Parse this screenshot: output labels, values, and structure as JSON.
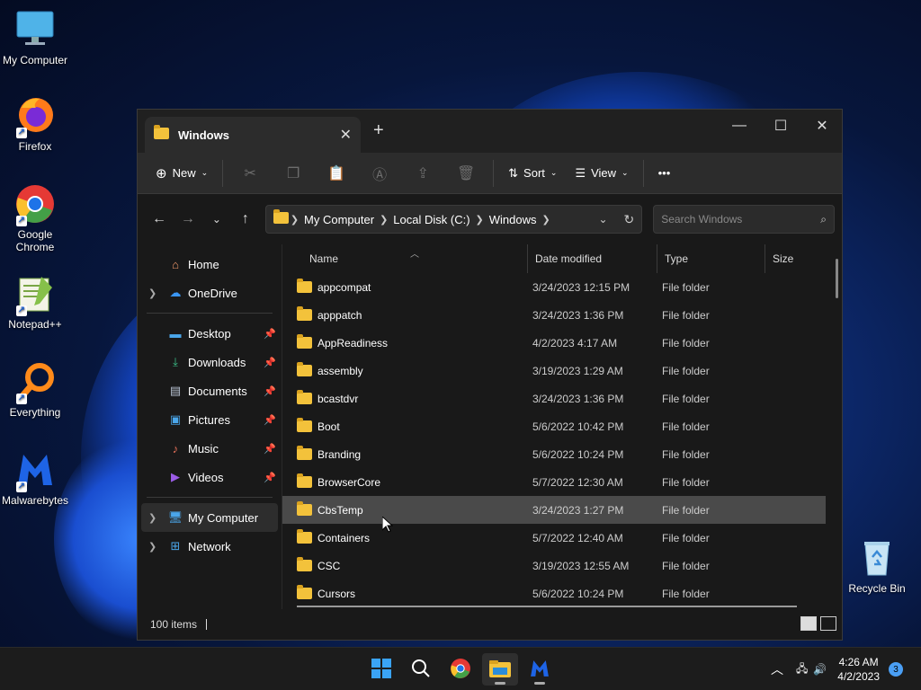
{
  "desktop": {
    "icons": [
      {
        "label": "My Computer"
      },
      {
        "label": "Firefox"
      },
      {
        "label": "Google Chrome"
      },
      {
        "label": "Notepad++"
      },
      {
        "label": "Everything"
      },
      {
        "label": "Malwarebytes"
      },
      {
        "label": "Recycle Bin"
      }
    ]
  },
  "window": {
    "tab_title": "Windows",
    "toolbar": {
      "new_label": "New",
      "sort_label": "Sort",
      "view_label": "View",
      "more_label": "•••"
    },
    "address": {
      "crumbs": [
        "My Computer",
        "Local Disk (C:)",
        "Windows"
      ]
    },
    "search": {
      "placeholder": "Search Windows"
    },
    "nav": {
      "home": "Home",
      "onedrive": "OneDrive",
      "desktop": "Desktop",
      "downloads": "Downloads",
      "documents": "Documents",
      "pictures": "Pictures",
      "music": "Music",
      "videos": "Videos",
      "mycomputer": "My Computer",
      "network": "Network"
    },
    "columns": {
      "name": "Name",
      "date": "Date modified",
      "type": "Type",
      "size": "Size"
    },
    "files": [
      {
        "name": "appcompat",
        "date": "3/24/2023 12:15 PM",
        "type": "File folder"
      },
      {
        "name": "apppatch",
        "date": "3/24/2023 1:36 PM",
        "type": "File folder"
      },
      {
        "name": "AppReadiness",
        "date": "4/2/2023 4:17 AM",
        "type": "File folder"
      },
      {
        "name": "assembly",
        "date": "3/19/2023 1:29 AM",
        "type": "File folder"
      },
      {
        "name": "bcastdvr",
        "date": "3/24/2023 1:36 PM",
        "type": "File folder"
      },
      {
        "name": "Boot",
        "date": "5/6/2022 10:42 PM",
        "type": "File folder"
      },
      {
        "name": "Branding",
        "date": "5/6/2022 10:24 PM",
        "type": "File folder"
      },
      {
        "name": "BrowserCore",
        "date": "5/7/2022 12:30 AM",
        "type": "File folder"
      },
      {
        "name": "CbsTemp",
        "date": "3/24/2023 1:27 PM",
        "type": "File folder"
      },
      {
        "name": "Containers",
        "date": "5/7/2022 12:40 AM",
        "type": "File folder"
      },
      {
        "name": "CSC",
        "date": "3/19/2023 12:55 AM",
        "type": "File folder"
      },
      {
        "name": "Cursors",
        "date": "5/6/2022 10:24 PM",
        "type": "File folder"
      }
    ],
    "status": {
      "items": "100 items"
    }
  },
  "taskbar": {
    "time": "4:26 AM",
    "date": "4/2/2023",
    "notifications": "3"
  }
}
